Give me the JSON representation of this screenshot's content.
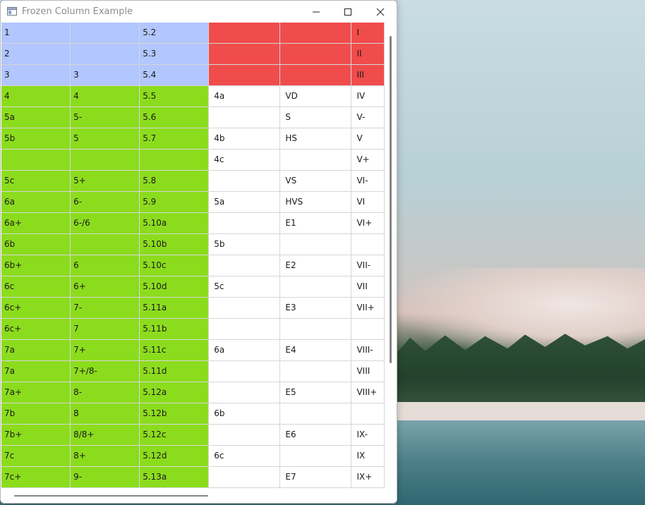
{
  "window": {
    "title": "Frozen Column Example"
  },
  "titlebar_buttons": {
    "minimize": "minimize-icon",
    "maximize": "maximize-icon",
    "close": "close-icon"
  },
  "colors": {
    "frozen_blue": "#b2c6ff",
    "frozen_red": "#f04c4c",
    "green": "#8cdc1e",
    "white": "#ffffff"
  },
  "rows": [
    {
      "cells": [
        "1",
        "",
        "5.2",
        "",
        "",
        "I"
      ],
      "style": "frozen"
    },
    {
      "cells": [
        "2",
        "",
        "5.3",
        "",
        "",
        "II"
      ],
      "style": "frozen"
    },
    {
      "cells": [
        "3",
        "3",
        "5.4",
        "",
        "",
        "III"
      ],
      "style": "frozen"
    },
    {
      "cells": [
        "4",
        "4",
        "5.5",
        "4a",
        "VD",
        "IV"
      ],
      "style": "body"
    },
    {
      "cells": [
        "5a",
        "5-",
        "5.6",
        "",
        "S",
        "V-"
      ],
      "style": "body"
    },
    {
      "cells": [
        "5b",
        "5",
        "5.7",
        "4b",
        "HS",
        "V"
      ],
      "style": "body"
    },
    {
      "cells": [
        "",
        "",
        "",
        "4c",
        "",
        "V+"
      ],
      "style": "body"
    },
    {
      "cells": [
        "5c",
        "5+",
        "5.8",
        "",
        "VS",
        "VI-"
      ],
      "style": "body"
    },
    {
      "cells": [
        "6a",
        "6-",
        "5.9",
        "5a",
        "HVS",
        "VI"
      ],
      "style": "body"
    },
    {
      "cells": [
        "6a+",
        "6-/6",
        "5.10a",
        "",
        "E1",
        "VI+"
      ],
      "style": "body"
    },
    {
      "cells": [
        "6b",
        "",
        "5.10b",
        "5b",
        "",
        ""
      ],
      "style": "body"
    },
    {
      "cells": [
        "6b+",
        "6",
        "5.10c",
        "",
        "E2",
        "VII-"
      ],
      "style": "body"
    },
    {
      "cells": [
        "6c",
        "6+",
        "5.10d",
        "5c",
        "",
        "VII"
      ],
      "style": "body"
    },
    {
      "cells": [
        "6c+",
        "7-",
        "5.11a",
        "",
        "E3",
        "VII+"
      ],
      "style": "body"
    },
    {
      "cells": [
        "6c+",
        "7",
        "5.11b",
        "",
        "",
        ""
      ],
      "style": "body"
    },
    {
      "cells": [
        "7a",
        "7+",
        "5.11c",
        "6a",
        "E4",
        "VIII-"
      ],
      "style": "body"
    },
    {
      "cells": [
        "7a",
        "7+/8-",
        "5.11d",
        "",
        "",
        "VIII"
      ],
      "style": "body"
    },
    {
      "cells": [
        "7a+",
        "8-",
        "5.12a",
        "",
        "E5",
        "VIII+"
      ],
      "style": "body"
    },
    {
      "cells": [
        "7b",
        "8",
        "5.12b",
        "6b",
        "",
        ""
      ],
      "style": "body"
    },
    {
      "cells": [
        "7b+",
        "8/8+",
        "5.12c",
        "",
        "E6",
        "IX-"
      ],
      "style": "body"
    },
    {
      "cells": [
        "7c",
        "8+",
        "5.12d",
        "6c",
        "",
        "IX"
      ],
      "style": "body"
    },
    {
      "cells": [
        "7c+",
        "9-",
        "5.13a",
        "",
        "E7",
        "IX+"
      ],
      "style": "body"
    }
  ]
}
